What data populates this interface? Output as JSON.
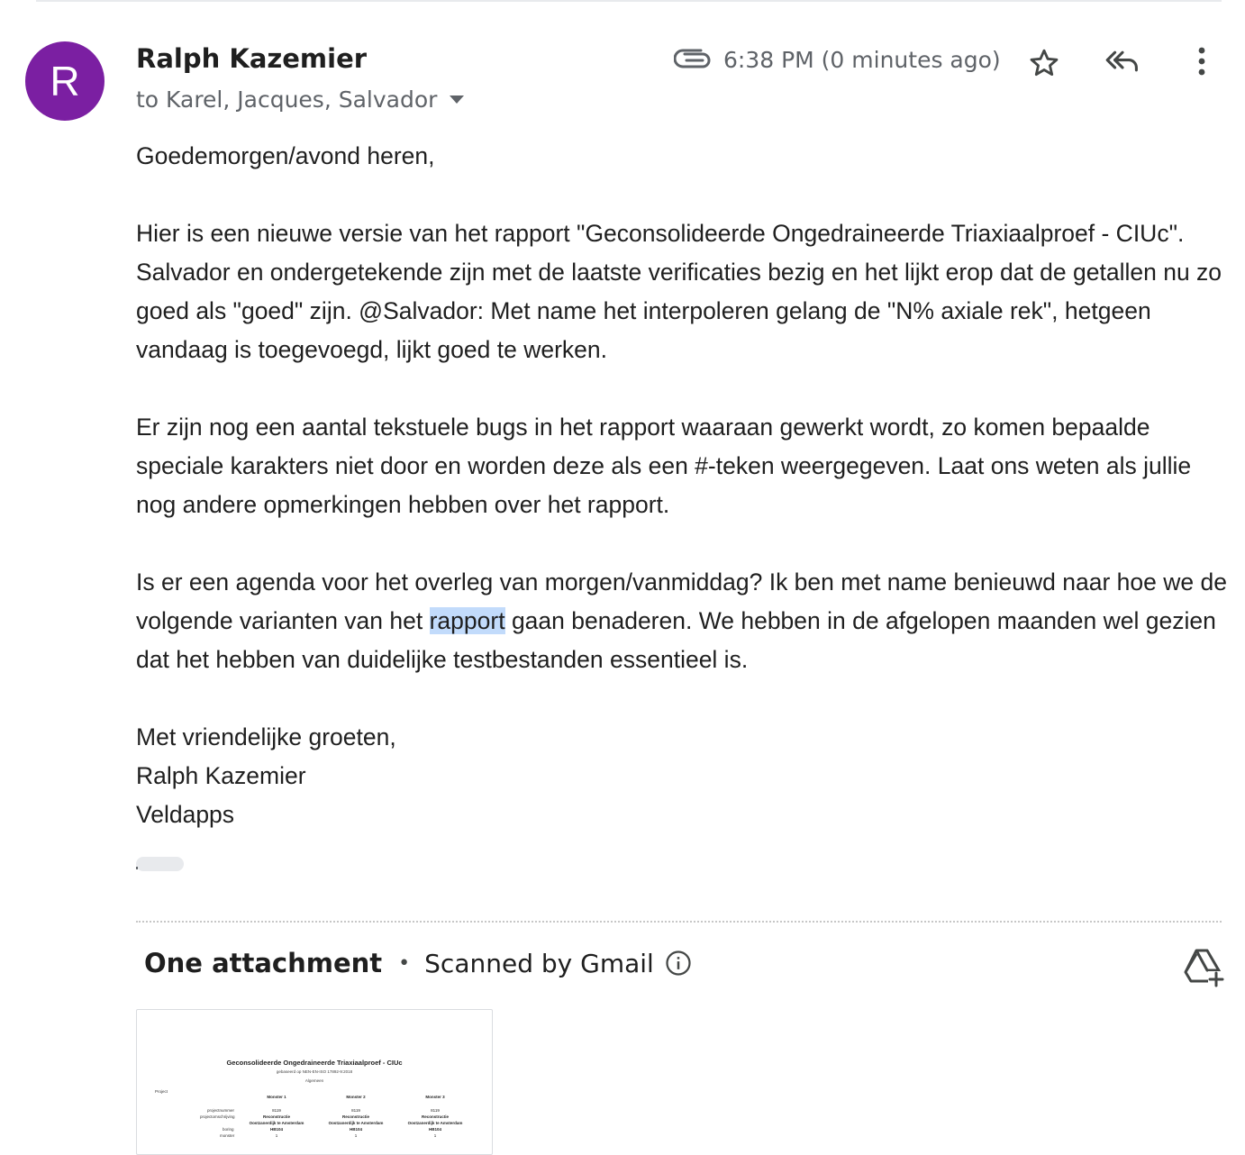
{
  "sender": {
    "avatar_letter": "R",
    "avatar_color": "#7b1fa2",
    "name": "Ralph Kazemier",
    "recipients": "to Karel, Jacques, Salvador"
  },
  "header": {
    "timestamp": "6:38 PM (0 minutes ago)",
    "icons": [
      "paperclip-icon",
      "star-icon",
      "reply-all-icon",
      "more-vert-icon"
    ]
  },
  "body": {
    "greeting": "Goedemorgen/avond heren,",
    "paragraph1": "Hier is een nieuwe versie van het rapport \"Geconsolideerde Ongedraineerde Triaxiaalproef - CIUc\". Salvador en ondergetekende zijn met de laatste verificaties bezig en het lijkt erop dat de getallen nu zo goed als \"goed\" zijn. @Salvador: Met name het interpoleren gelang de \"N% axiale rek\", hetgeen vandaag is toegevoegd, lijkt goed te werken.",
    "paragraph2": "Er zijn nog een aantal tekstuele bugs in het rapport waaraan gewerkt wordt, zo komen bepaalde speciale karakters niet door en worden deze als een #-teken weergegeven. Laat ons weten als jullie nog andere opmerkingen hebben over het rapport.",
    "paragraph3_before": "Is er een agenda voor het overleg van morgen/vanmiddag? Ik ben met name benieuwd naar hoe we de volgende varianten van het ",
    "paragraph3_highlight": "rapport",
    "paragraph3_after": " gaan benaderen. We hebben in de afgelopen maanden wel gezien dat het hebben van duidelijke testbestanden essentieel is.",
    "signoff": "Met vriendelijke groeten,",
    "sig_name": "Ralph Kazemier",
    "sig_company": "Veldapps"
  },
  "attachments": {
    "title": "One attachment",
    "separator": "•",
    "scanned": "Scanned by Gmail",
    "thumbnail": {
      "title": "Geconsolideerde Ongedraineerde Triaxiaalproef - CIUc",
      "subtitle": "gebaseerd op NEN-EN-ISO 17892-9:2018",
      "section": "Algemeen",
      "row_project": "Project",
      "row_labels": [
        "projectnummer",
        "projectomschrijving",
        "boring",
        "monster"
      ],
      "columns": [
        {
          "name": "Monster 1",
          "nummer": "8119",
          "omschrijving": "Reconstructie",
          "locatie": "Oostzanerdijk te Amsterdam",
          "boring": "HB104",
          "monster": "1"
        },
        {
          "name": "Monster 2",
          "nummer": "8119",
          "omschrijving": "Reconstructie",
          "locatie": "Oostzanerdijk te Amsterdam",
          "boring": "HB104",
          "monster": "1"
        },
        {
          "name": "Monster 3",
          "nummer": "8119",
          "omschrijving": "Reconstructie",
          "locatie": "Oostzanerdijk te Amsterdam",
          "boring": "HB104",
          "monster": "1"
        }
      ]
    }
  }
}
